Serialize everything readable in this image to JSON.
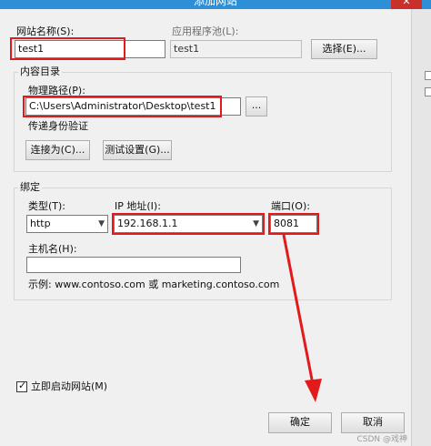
{
  "window": {
    "title": "添加网站",
    "close_label": "✕"
  },
  "site_name": {
    "label": "网站名称(S):",
    "value": "test1"
  },
  "app_pool": {
    "label": "应用程序池(L):",
    "value": "test1",
    "select_label": "选择(E)..."
  },
  "content_dir": {
    "group_label": "内容目录",
    "path_label": "物理路径(P):",
    "path_value": "C:\\Users\\Administrator\\Desktop\\test1",
    "browse_label": "...",
    "auth_label": "传递身份验证",
    "connect_as_label": "连接为(C)...",
    "test_settings_label": "测试设置(G)..."
  },
  "binding": {
    "group_label": "绑定",
    "type_label": "类型(T):",
    "type_value": "http",
    "ip_label": "IP 地址(I):",
    "ip_value": "192.168.1.1",
    "port_label": "端口(O):",
    "port_value": "8081",
    "host_label": "主机名(H):",
    "host_value": "",
    "example_text": "示例: www.contoso.com 或 marketing.contoso.com"
  },
  "start_immediately": {
    "label": "立即启动网站(M)",
    "checked": true
  },
  "buttons": {
    "ok_label": "确定",
    "cancel_label": "取消"
  },
  "watermark": "CSDN @戏神",
  "colors": {
    "highlight": "#e11b1b",
    "titlebar": "#2d8fd5"
  }
}
